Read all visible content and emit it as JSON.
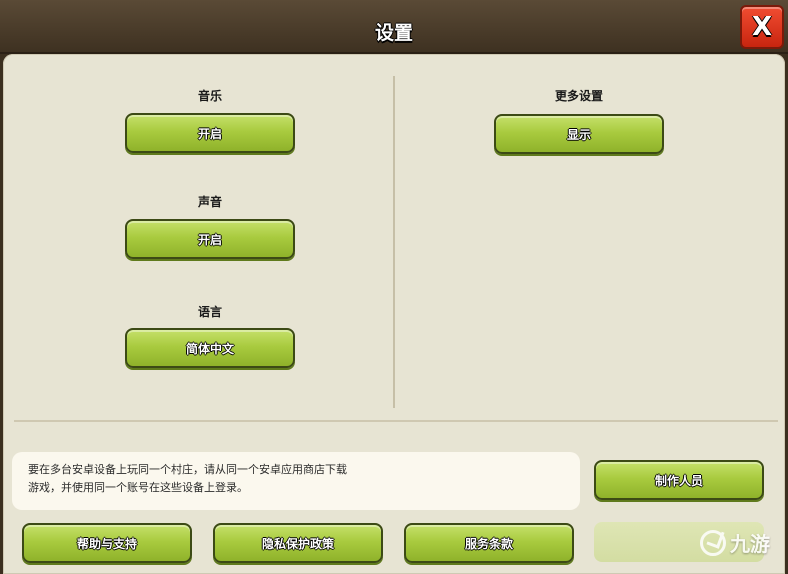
{
  "window": {
    "title": "设置",
    "close_label": "X"
  },
  "left_column": {
    "music": {
      "label": "音乐",
      "button": "开启"
    },
    "sound": {
      "label": "声音",
      "button": "开启"
    },
    "language": {
      "label": "语言",
      "button": "简体中文"
    }
  },
  "right_column": {
    "more_settings": {
      "label": "更多设置",
      "button": "显示"
    }
  },
  "info": {
    "line1": "要在多台安卓设备上玩同一个村庄，请从同一个安卓应用商店下载",
    "line2": "游戏，并使用同一个账号在这些设备上登录。"
  },
  "credits_button": "制作人员",
  "bottom_buttons": {
    "help": "帮助与支持",
    "privacy": "隐私保护政策",
    "terms": "服务条款"
  },
  "watermark": {
    "text": "九游"
  },
  "colors": {
    "button_green": "#a9cb3f",
    "panel_bg": "#e7e4d3",
    "close_red": "#e0381e",
    "title_bar": "#4a3c2a"
  }
}
